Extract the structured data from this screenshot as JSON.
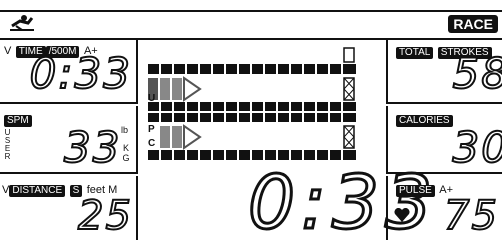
{
  "header": {
    "mode_badge": "RACE",
    "icon": "rower-icon"
  },
  "left": {
    "time_panel": {
      "v": "V",
      "label": "TIME",
      "unit": "/500M",
      "flag": "A+",
      "value": "0:33"
    },
    "spm_panel": {
      "label": "SPM",
      "user": "USER",
      "value": "33",
      "units_top": "lb",
      "units_bottom": "KG"
    },
    "distance_panel": {
      "v": "V",
      "label": "DISTANCE",
      "s_badge": "S",
      "units": "feet M",
      "value": "25"
    }
  },
  "center": {
    "lane_u_label": "U",
    "lane_p_label": "P",
    "lane_c_label": "C",
    "big_time": "0:33"
  },
  "right": {
    "strokes_panel": {
      "total": "TOTAL",
      "label": "STROKES",
      "value": "58"
    },
    "calories_panel": {
      "label": "CALORIES",
      "value": "30"
    },
    "pulse_panel": {
      "label": "PULSE",
      "flag": "A+",
      "heart": "heart-icon",
      "value": "75"
    }
  }
}
